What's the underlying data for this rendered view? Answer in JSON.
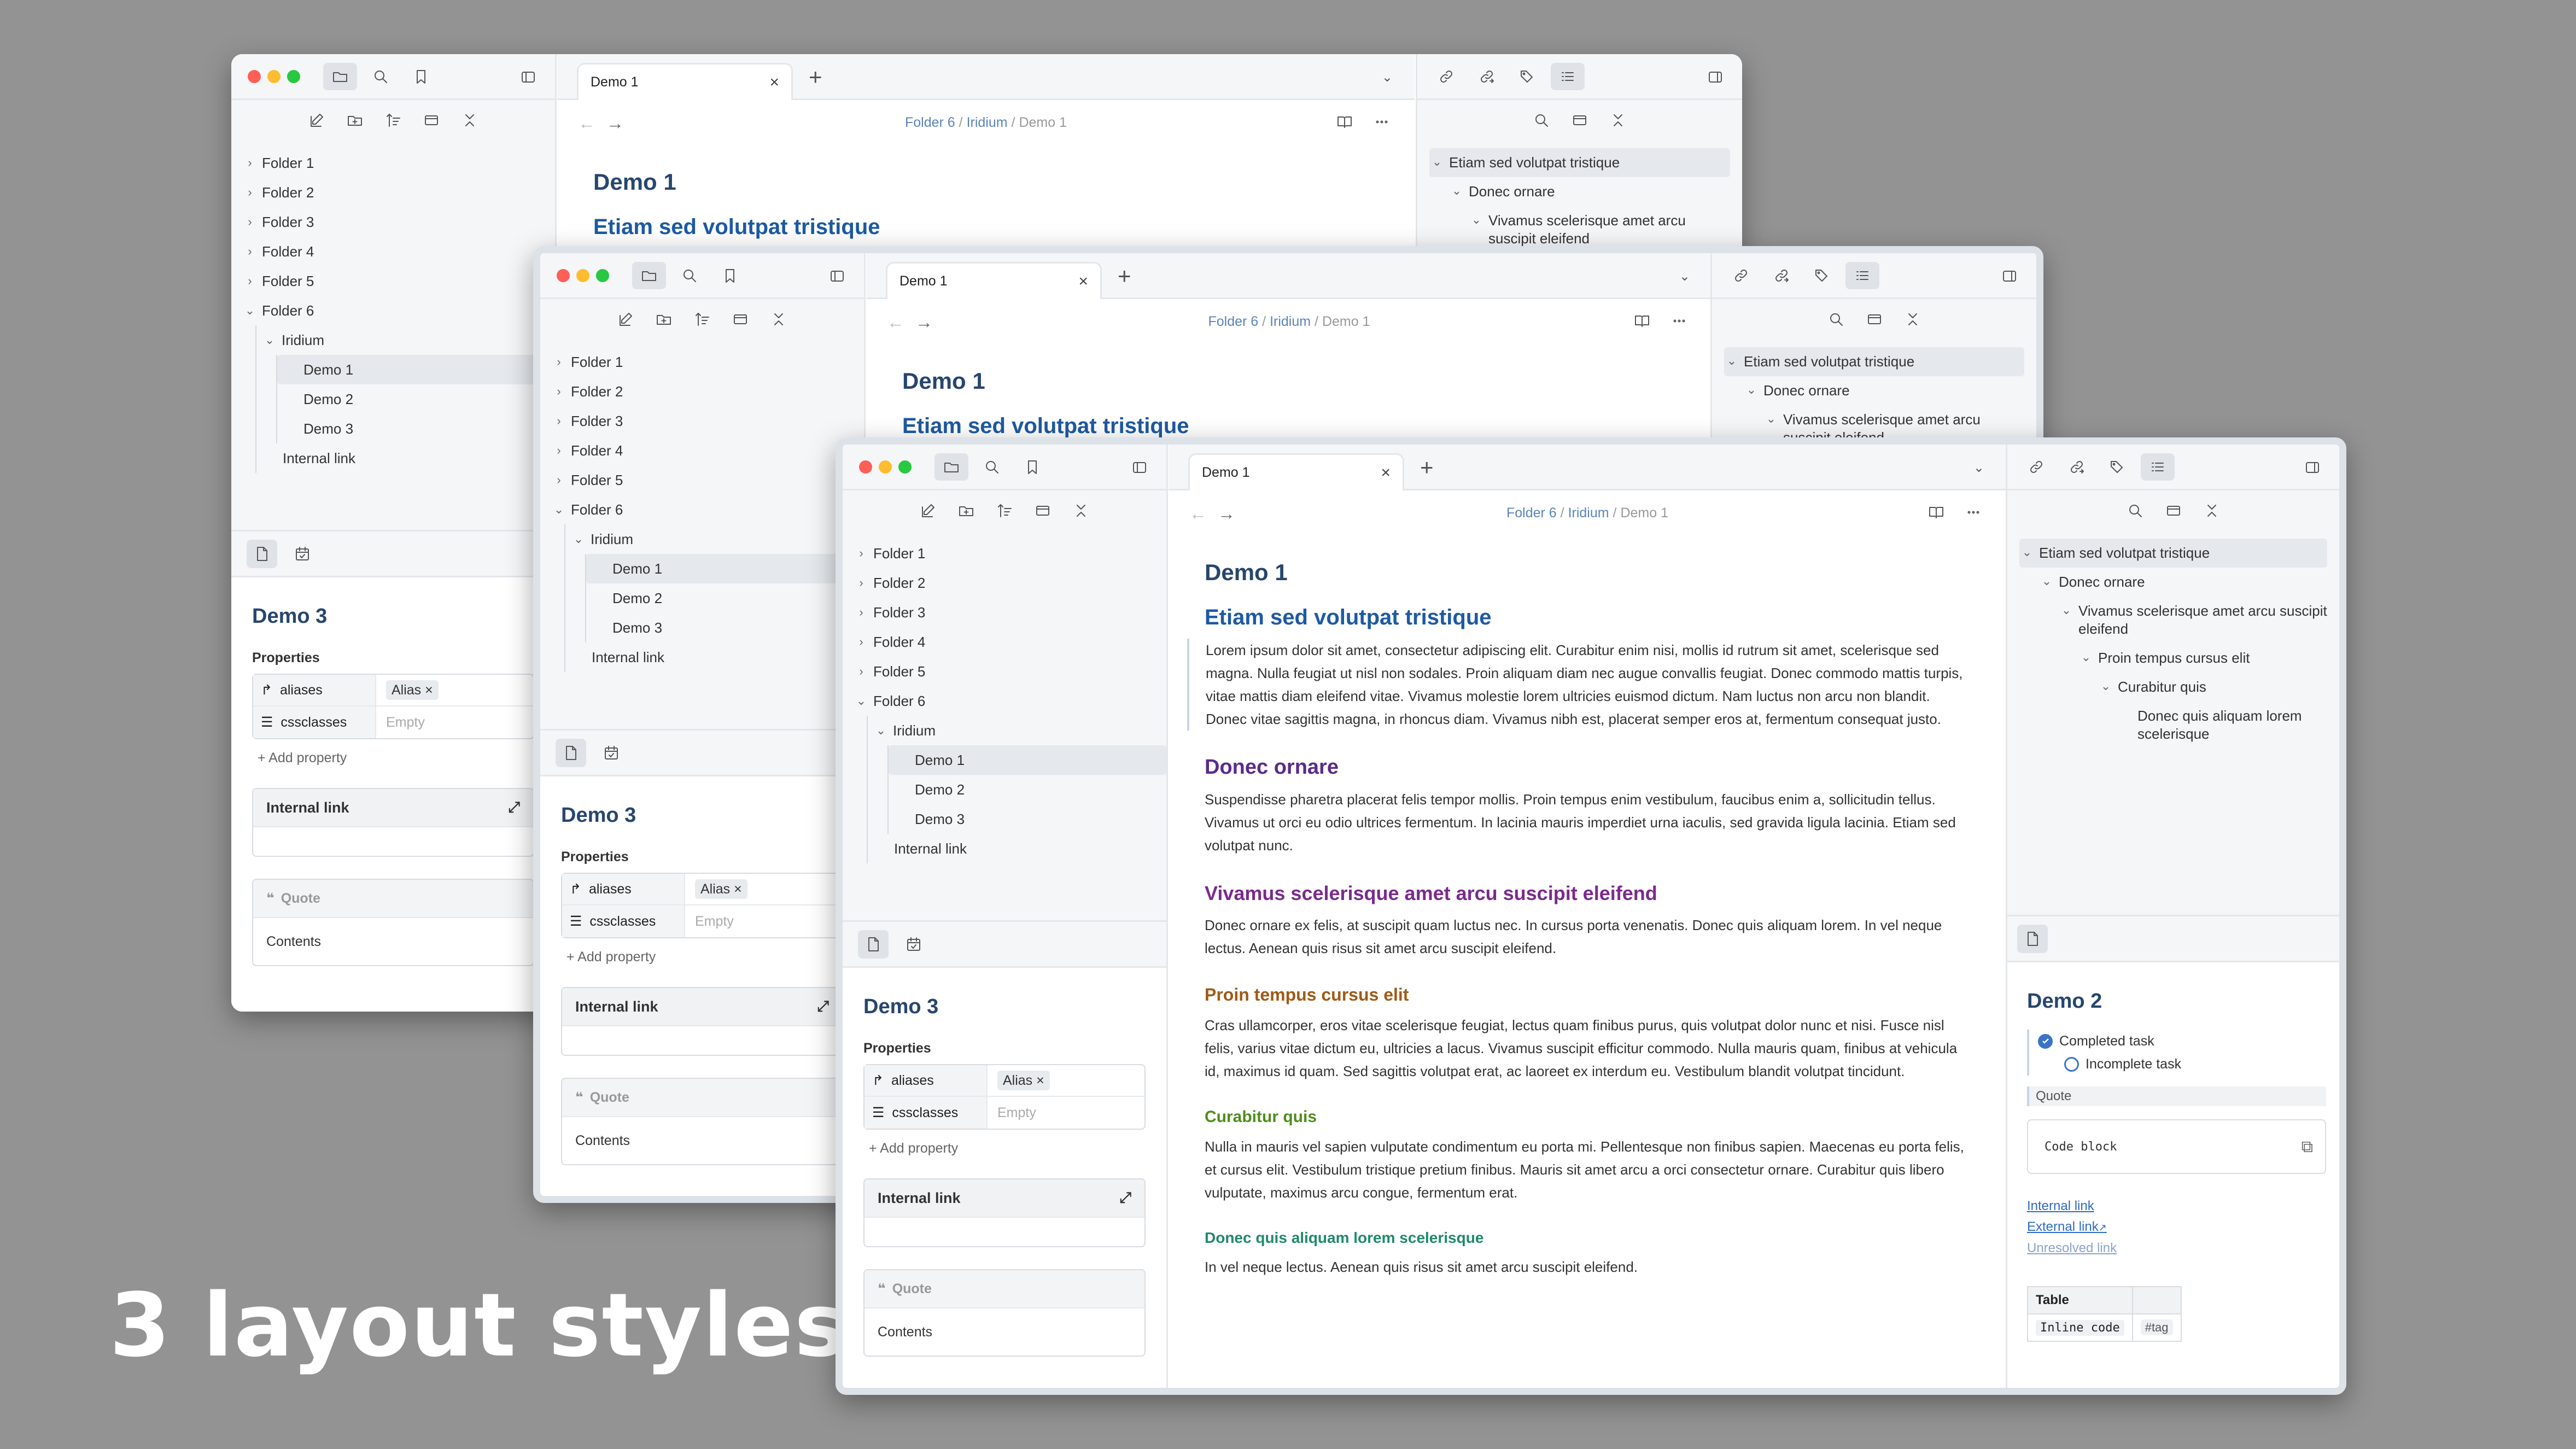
{
  "caption": "3 layout styles",
  "colors": {
    "accent": "#3a73c9",
    "heading": "#27466e",
    "background": "#939393"
  },
  "left": {
    "tabs": [
      "folder-icon",
      "search-icon",
      "bookmark-icon"
    ],
    "toolbar": [
      "new-note-icon",
      "new-folder-icon",
      "sort-icon",
      "collapse-icon",
      "expand-icon"
    ],
    "tree": {
      "folders": [
        "Folder 1",
        "Folder 2",
        "Folder 3",
        "Folder 4",
        "Folder 5",
        "Folder 6"
      ],
      "subfolder": "Iridium",
      "notes": [
        "Demo 1",
        "Demo 2",
        "Demo 3"
      ],
      "internal": "Internal link"
    },
    "panel": {
      "title": "Demo 3",
      "properties_label": "Properties",
      "prop_aliases": "aliases",
      "alias_chip": "Alias",
      "prop_css": "cssclasses",
      "empty": "Empty",
      "add_property": "+ Add property",
      "internal_link": "Internal link",
      "quote": "Quote",
      "contents": "Contents"
    }
  },
  "center": {
    "tab_title": "Demo 1",
    "breadcrumb": [
      "Folder 6",
      "Iridium",
      "Demo 1"
    ],
    "breadcrumb_sep": "/",
    "title": "Demo 1",
    "h2": "Etiam sed volutpat tristique",
    "p1": "Lorem ipsum dolor sit amet, consectetur adipiscing elit. Curabitur enim nisi, mollis id rutrum sit amet, scelerisque sed magna. Nulla feugiat ut nisl non sodales. Proin aliquam diam nec augue convallis feugiat. Donec commodo mattis turpis, vitae mattis diam eleifend vitae. Vivamus molestie lorem ultricies euismod dictum. Nam luctus non arcu non blandit. Donec vitae sagittis magna, in rhoncus diam. Vivamus nibh est, placerat semper eros at, fermentum consequat justo.",
    "h3": "Donec ornare",
    "p2": "Suspendisse pharetra placerat felis tempor mollis. Proin tempus enim vestibulum, faucibus enim a, sollicitudin tellus. Vivamus ut orci eu odio ultrices fermentum. In lacinia mauris imperdiet urna iaculis, sed gravida ligula lacinia. Etiam sed volutpat nunc.",
    "h4": "Vivamus scelerisque amet arcu suscipit eleifend",
    "p3": "Donec ornare ex felis, at suscipit quam luctus nec. In cursus porta venenatis. Donec quis aliquam lorem.  In vel neque lectus. Aenean quis risus sit amet arcu suscipit eleifend.",
    "h5": "Proin tempus cursus elit",
    "p4": "Cras ullamcorper, eros vitae scelerisque feugiat, lectus quam finibus purus, quis volutpat dolor nunc et nisi. Fusce nisl felis, varius vitae dictum eu, ultricies a lacus. Vivamus suscipit efficitur commodo. Nulla mauris quam, finibus at vehicula id, maximus id quam. Sed sagittis volutpat erat, ac laoreet ex interdum eu. Vestibulum blandit volutpat tincidunt.",
    "h6": "Curabitur quis",
    "p5": "Nulla in mauris vel sapien vulputate condimentum eu porta mi. Pellentesque non finibus sapien. Maecenas eu porta felis, et cursus elit. Vestibulum tristique pretium finibus. Mauris sit amet arcu a orci consectetur ornare. Curabitur quis libero vulputate, maximus arcu congue, fermentum erat.",
    "h7": "Donec quis aliquam lorem scelerisque",
    "p6": " In vel neque lectus. Aenean quis risus sit amet arcu suscipit eleifend."
  },
  "right": {
    "tabs": [
      "link-icon",
      "link-out-icon",
      "tags-icon",
      "outline-icon"
    ],
    "outline": [
      {
        "text": "Etiam sed volutpat tristique",
        "level": 0
      },
      {
        "text": "Donec ornare",
        "level": 1
      },
      {
        "text": "Vivamus scelerisque amet arcu suscipit eleifend",
        "level": 2
      },
      {
        "text": "Proin tempus cursus elit",
        "level": 3
      },
      {
        "text": "Curabitur quis",
        "level": 4
      },
      {
        "text": "Donec quis aliquam lorem scelerisque",
        "level": 5
      }
    ],
    "panel": {
      "title": "Demo 2",
      "task_done": "Completed task",
      "task_open": "Incomplete task",
      "quote": "Quote",
      "code": "Code block",
      "internal_link": "Internal link",
      "external_link": "External link",
      "unresolved_link": "Unresolved link",
      "table_header": "Table",
      "inline_code": "Inline code",
      "tag": "#tag"
    }
  }
}
